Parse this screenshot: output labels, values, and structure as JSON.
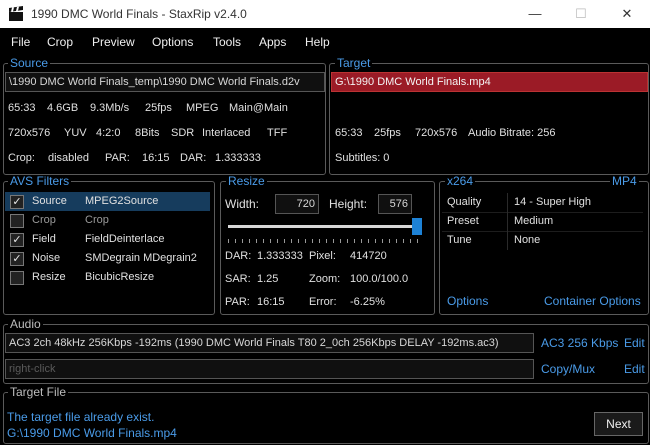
{
  "window": {
    "title": "1990 DMC World Finals - StaxRip v2.4.0"
  },
  "menu": [
    "File",
    "Crop",
    "Preview",
    "Options",
    "Tools",
    "Apps",
    "Help"
  ],
  "source": {
    "title": "Source",
    "path": "\\1990 DMC World Finals_temp\\1990 DMC World Finals.d2v",
    "info1": [
      "65:33",
      "4.6GB",
      "9.3Mb/s",
      "25fps",
      "MPEG",
      "Main@Main"
    ],
    "info2": [
      "720x576",
      "YUV",
      "4:2:0",
      "8Bits",
      "SDR",
      "Interlaced",
      "TFF"
    ],
    "crop_label": "Crop:",
    "crop_value": "disabled",
    "par_label": "PAR:",
    "par_value": "16:15",
    "dar_label": "DAR:",
    "dar_value": "1.333333"
  },
  "target": {
    "title": "Target",
    "path": "G:\\1990 DMC World Finals.mp4",
    "info": [
      "65:33",
      "25fps",
      "720x576",
      "Audio Bitrate: 256"
    ],
    "subtitles": "Subtitles: 0"
  },
  "filters": {
    "title": "AVS Filters",
    "rows": [
      {
        "checked": true,
        "category": "Source",
        "name": "MPEG2Source",
        "selected": true
      },
      {
        "checked": false,
        "category": "Crop",
        "name": "Crop"
      },
      {
        "checked": true,
        "category": "Field",
        "name": "FieldDeinterlace"
      },
      {
        "checked": true,
        "category": "Noise",
        "name": "SMDegrain MDegrain2"
      },
      {
        "checked": false,
        "category": "Resize",
        "name": "BicubicResize"
      }
    ]
  },
  "resize": {
    "title": "Resize",
    "width_label": "Width:",
    "width_value": "720",
    "height_label": "Height:",
    "height_value": "576",
    "slider_level": 1.0,
    "dar_label": "DAR:",
    "dar_value": "1.333333",
    "pixel_label": "Pixel:",
    "pixel_value": "414720",
    "sar_label": "SAR:",
    "sar_value": "1.25",
    "zoom_label": "Zoom:",
    "zoom_value": "100.0/100.0",
    "par_label": "PAR:",
    "par_value": "16:15",
    "error_label": "Error:",
    "error_value": "-6.25%"
  },
  "encoder": {
    "title": "x264",
    "container": "MP4",
    "rows": [
      {
        "key": "Quality",
        "value": "14 - Super High"
      },
      {
        "key": "Preset",
        "value": "Medium"
      },
      {
        "key": "Tune",
        "value": "None"
      }
    ],
    "options_link": "Options",
    "container_options_link": "Container Options"
  },
  "audio": {
    "title": "Audio",
    "track1": "AC3 2ch 48kHz 256Kbps -192ms (1990 DMC World Finals T80 2_0ch 256Kbps DELAY -192ms.ac3)",
    "track1_profile": "AC3 256 Kbps",
    "track2_placeholder": "right-click",
    "track2_profile": "Copy/Mux",
    "edit": "Edit"
  },
  "target_file": {
    "title": "Target File",
    "line1": "The target file already exist.",
    "line2": "G:\\1990 DMC World Finals.mp4",
    "next": "Next"
  },
  "colors": {
    "accent": "#4a9be8",
    "target_bg": "#9b1b26",
    "selection": "#163c5d"
  }
}
